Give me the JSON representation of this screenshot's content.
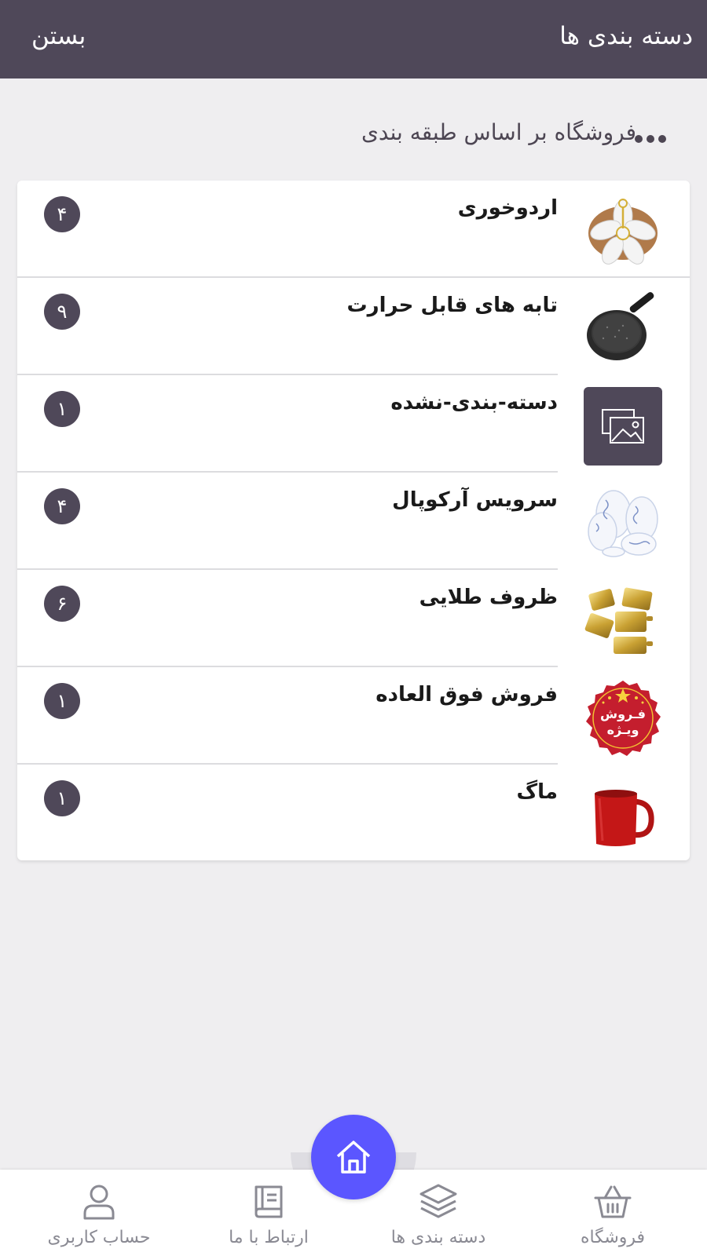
{
  "header": {
    "title": "دسته بندی ها",
    "close_label": "بستن"
  },
  "section": {
    "title": "فروشگاه بر اساس طبقه بندی"
  },
  "categories": [
    {
      "label": "اردوخوری",
      "count": "۴",
      "icon": "flower-serving-dish-icon"
    },
    {
      "label": "تابه های قابل حرارت",
      "count": "۹",
      "icon": "frying-pan-icon"
    },
    {
      "label": "دسته-بندی-نشده",
      "count": "۱",
      "icon": "image-placeholder-icon"
    },
    {
      "label": "سرویس آرکوپال",
      "count": "۴",
      "icon": "arcopal-dish-set-icon"
    },
    {
      "label": "ظروف طلایی",
      "count": "۶",
      "icon": "golden-cookware-icon"
    },
    {
      "label": "فروش فوق العاده",
      "count": "۱",
      "icon": "special-sale-badge-icon"
    },
    {
      "label": "ماگ",
      "count": "۱",
      "icon": "red-mug-icon"
    }
  ],
  "sale_badge": {
    "line1": "فـروش",
    "line2": "ویـژه"
  },
  "bottom_nav": {
    "items": [
      {
        "label": "فروشگاه",
        "icon": "basket-icon"
      },
      {
        "label": "دسته بندی ها",
        "icon": "layers-icon"
      },
      {
        "label": "ارتباط با ما",
        "icon": "book-icon"
      },
      {
        "label": "حساب کاربری",
        "icon": "user-icon"
      }
    ],
    "home_icon": "home-icon"
  },
  "colors": {
    "header_bg": "#4f4859",
    "page_bg": "#efeef0",
    "accent_home": "#5b56ff",
    "badge_bg": "#4f4859"
  }
}
